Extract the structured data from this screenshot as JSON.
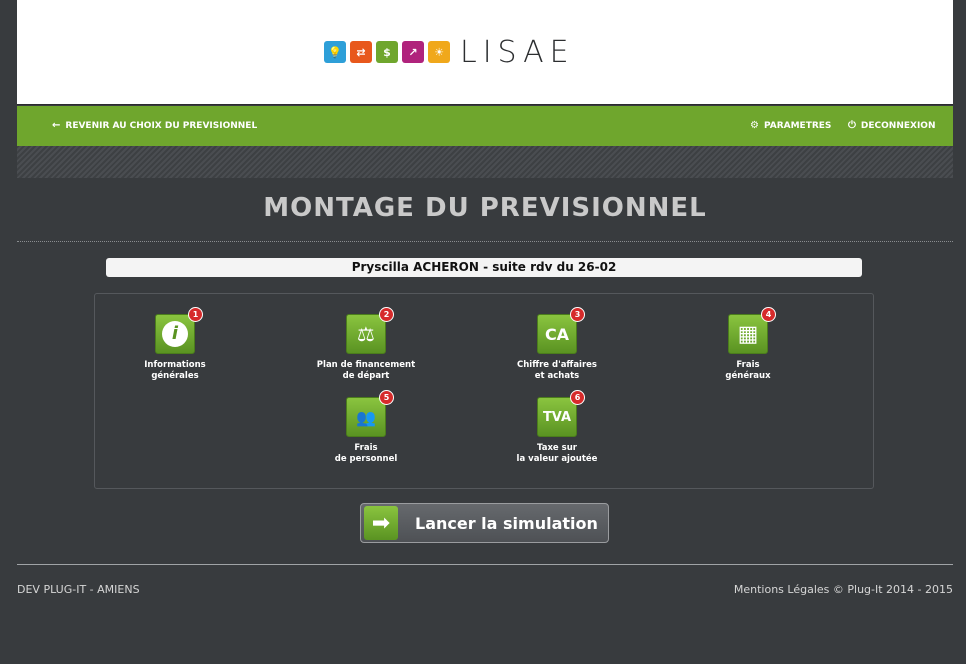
{
  "logo": {
    "text": "LISAE",
    "tiles": [
      {
        "icon": "lightbulb-icon",
        "color": "#2e9fd8",
        "glyph": "💡"
      },
      {
        "icon": "arrows-icon",
        "color": "#e8581c",
        "glyph": "⇄"
      },
      {
        "icon": "money-bag-icon",
        "color": "#6fa62d",
        "glyph": "$"
      },
      {
        "icon": "growth-chart-icon",
        "color": "#b0237c",
        "glyph": "↗"
      },
      {
        "icon": "sun-icon",
        "color": "#f0a81b",
        "glyph": "☀"
      }
    ]
  },
  "nav": {
    "back_label": "REVENIR AU CHOIX DU PREVISIONNEL",
    "params_label": "PARAMETRES",
    "logout_label": "DECONNEXION"
  },
  "page": {
    "title": "MONTAGE DU PREVISIONNEL",
    "client_label": "Pryscilla ACHERON - suite rdv du 26-02"
  },
  "modules": [
    {
      "badge": "1",
      "glyph": "i",
      "icon": "info-icon",
      "label": "Informations\ngénérales"
    },
    {
      "badge": "2",
      "glyph": "⚖",
      "icon": "balance-icon",
      "label": "Plan de financement\nde départ"
    },
    {
      "badge": "3",
      "glyph": "CA",
      "icon": "ca-icon",
      "label": "Chiffre d'affaires\net achats"
    },
    {
      "badge": "4",
      "glyph": "▦",
      "icon": "calculator-icon",
      "label": "Frais\ngénéraux"
    },
    {
      "badge": "5",
      "glyph": "👥",
      "icon": "people-icon",
      "label": "Frais\nde personnel"
    },
    {
      "badge": "6",
      "glyph": "TVA",
      "icon": "tva-icon",
      "label": "Taxe sur\nla valeur ajoutée"
    }
  ],
  "launch": {
    "label": "Lancer la simulation"
  },
  "footer": {
    "left": "DEV PLUG-IT - AMIENS",
    "right": "Mentions Légales  © Plug-It 2014 - 2015"
  },
  "colors": {
    "accent_green": "#6fa62d",
    "background": "#383b3e",
    "badge_red": "#d62b2b"
  }
}
